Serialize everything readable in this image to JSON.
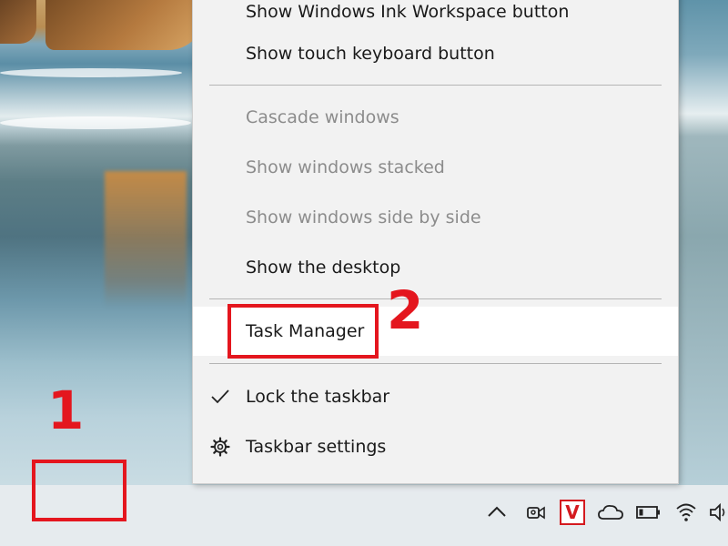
{
  "menu": {
    "items": [
      {
        "label": "Show Windows Ink Workspace button"
      },
      {
        "label": "Show touch keyboard button"
      },
      {
        "label": "Cascade windows"
      },
      {
        "label": "Show windows stacked"
      },
      {
        "label": "Show windows side by side"
      },
      {
        "label": "Show the desktop"
      },
      {
        "label": "Task Manager"
      },
      {
        "label": "Lock the taskbar"
      },
      {
        "label": "Taskbar settings"
      }
    ]
  },
  "annotations": {
    "step1": "1",
    "step2": "2",
    "color": "#e4161e"
  },
  "tray": {
    "icons": [
      "chevron-up-icon",
      "meet-now-icon",
      "antivirus-v-icon",
      "onedrive-cloud-icon",
      "battery-icon",
      "wifi-icon",
      "volume-icon"
    ],
    "antivirus_letter": "V"
  }
}
